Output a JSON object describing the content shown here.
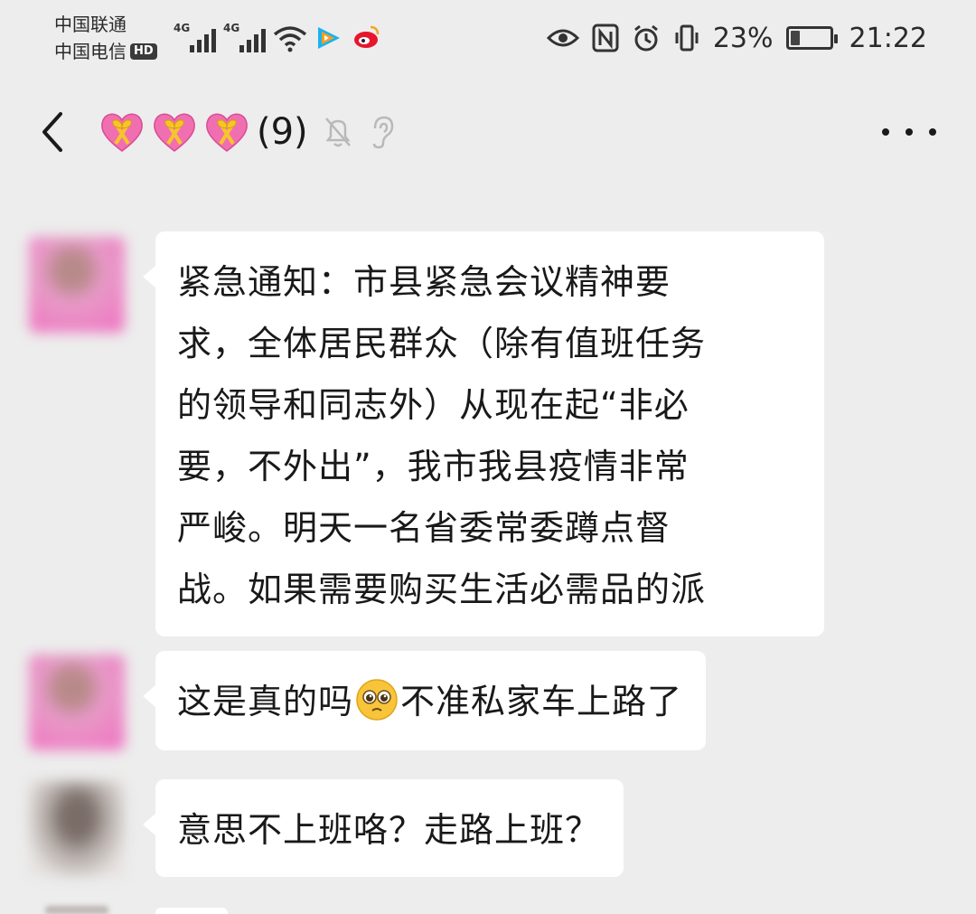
{
  "status_bar": {
    "carrier_1": "中国联通",
    "carrier_2": "中国电信",
    "hd_badge": "HD",
    "network_1": "4G",
    "network_2": "4G",
    "battery_percent": "23%",
    "battery_level": 0.23,
    "time": "21:22",
    "icons": [
      "signal-icon",
      "wifi-icon",
      "tencent-video-icon",
      "weibo-icon",
      "eye-icon",
      "nfc-icon",
      "alarm-icon",
      "vibrate-icon",
      "battery-icon"
    ]
  },
  "header": {
    "member_count": "(9)",
    "icons": [
      "back-icon",
      "gift-heart-emoji",
      "mute-icon",
      "ear-icon",
      "more-icon"
    ]
  },
  "messages": [
    {
      "avatar": "pink-avatar",
      "lines": [
        "紧急通知：市县紧急会议精神要",
        "求，全体居民群众（除有值班任务",
        "的领导和同志外）从现在起“非必",
        "要，不外出”，我市我县疫情非常",
        "严峻。明天一名省委常委蹲点督",
        "战。如果需要购买生活必需品的派"
      ]
    },
    {
      "avatar": "pink-avatar",
      "text_before_emoji": "这是真的吗",
      "emoji": "pleading-face-emoji",
      "text_after_emoji": "不准私家车上路了"
    },
    {
      "avatar": "photo-avatar",
      "text": "意思不上班咯？走路上班？"
    }
  ],
  "colors": {
    "background": "#ededed",
    "bubble": "#ffffff",
    "text": "#191919"
  }
}
